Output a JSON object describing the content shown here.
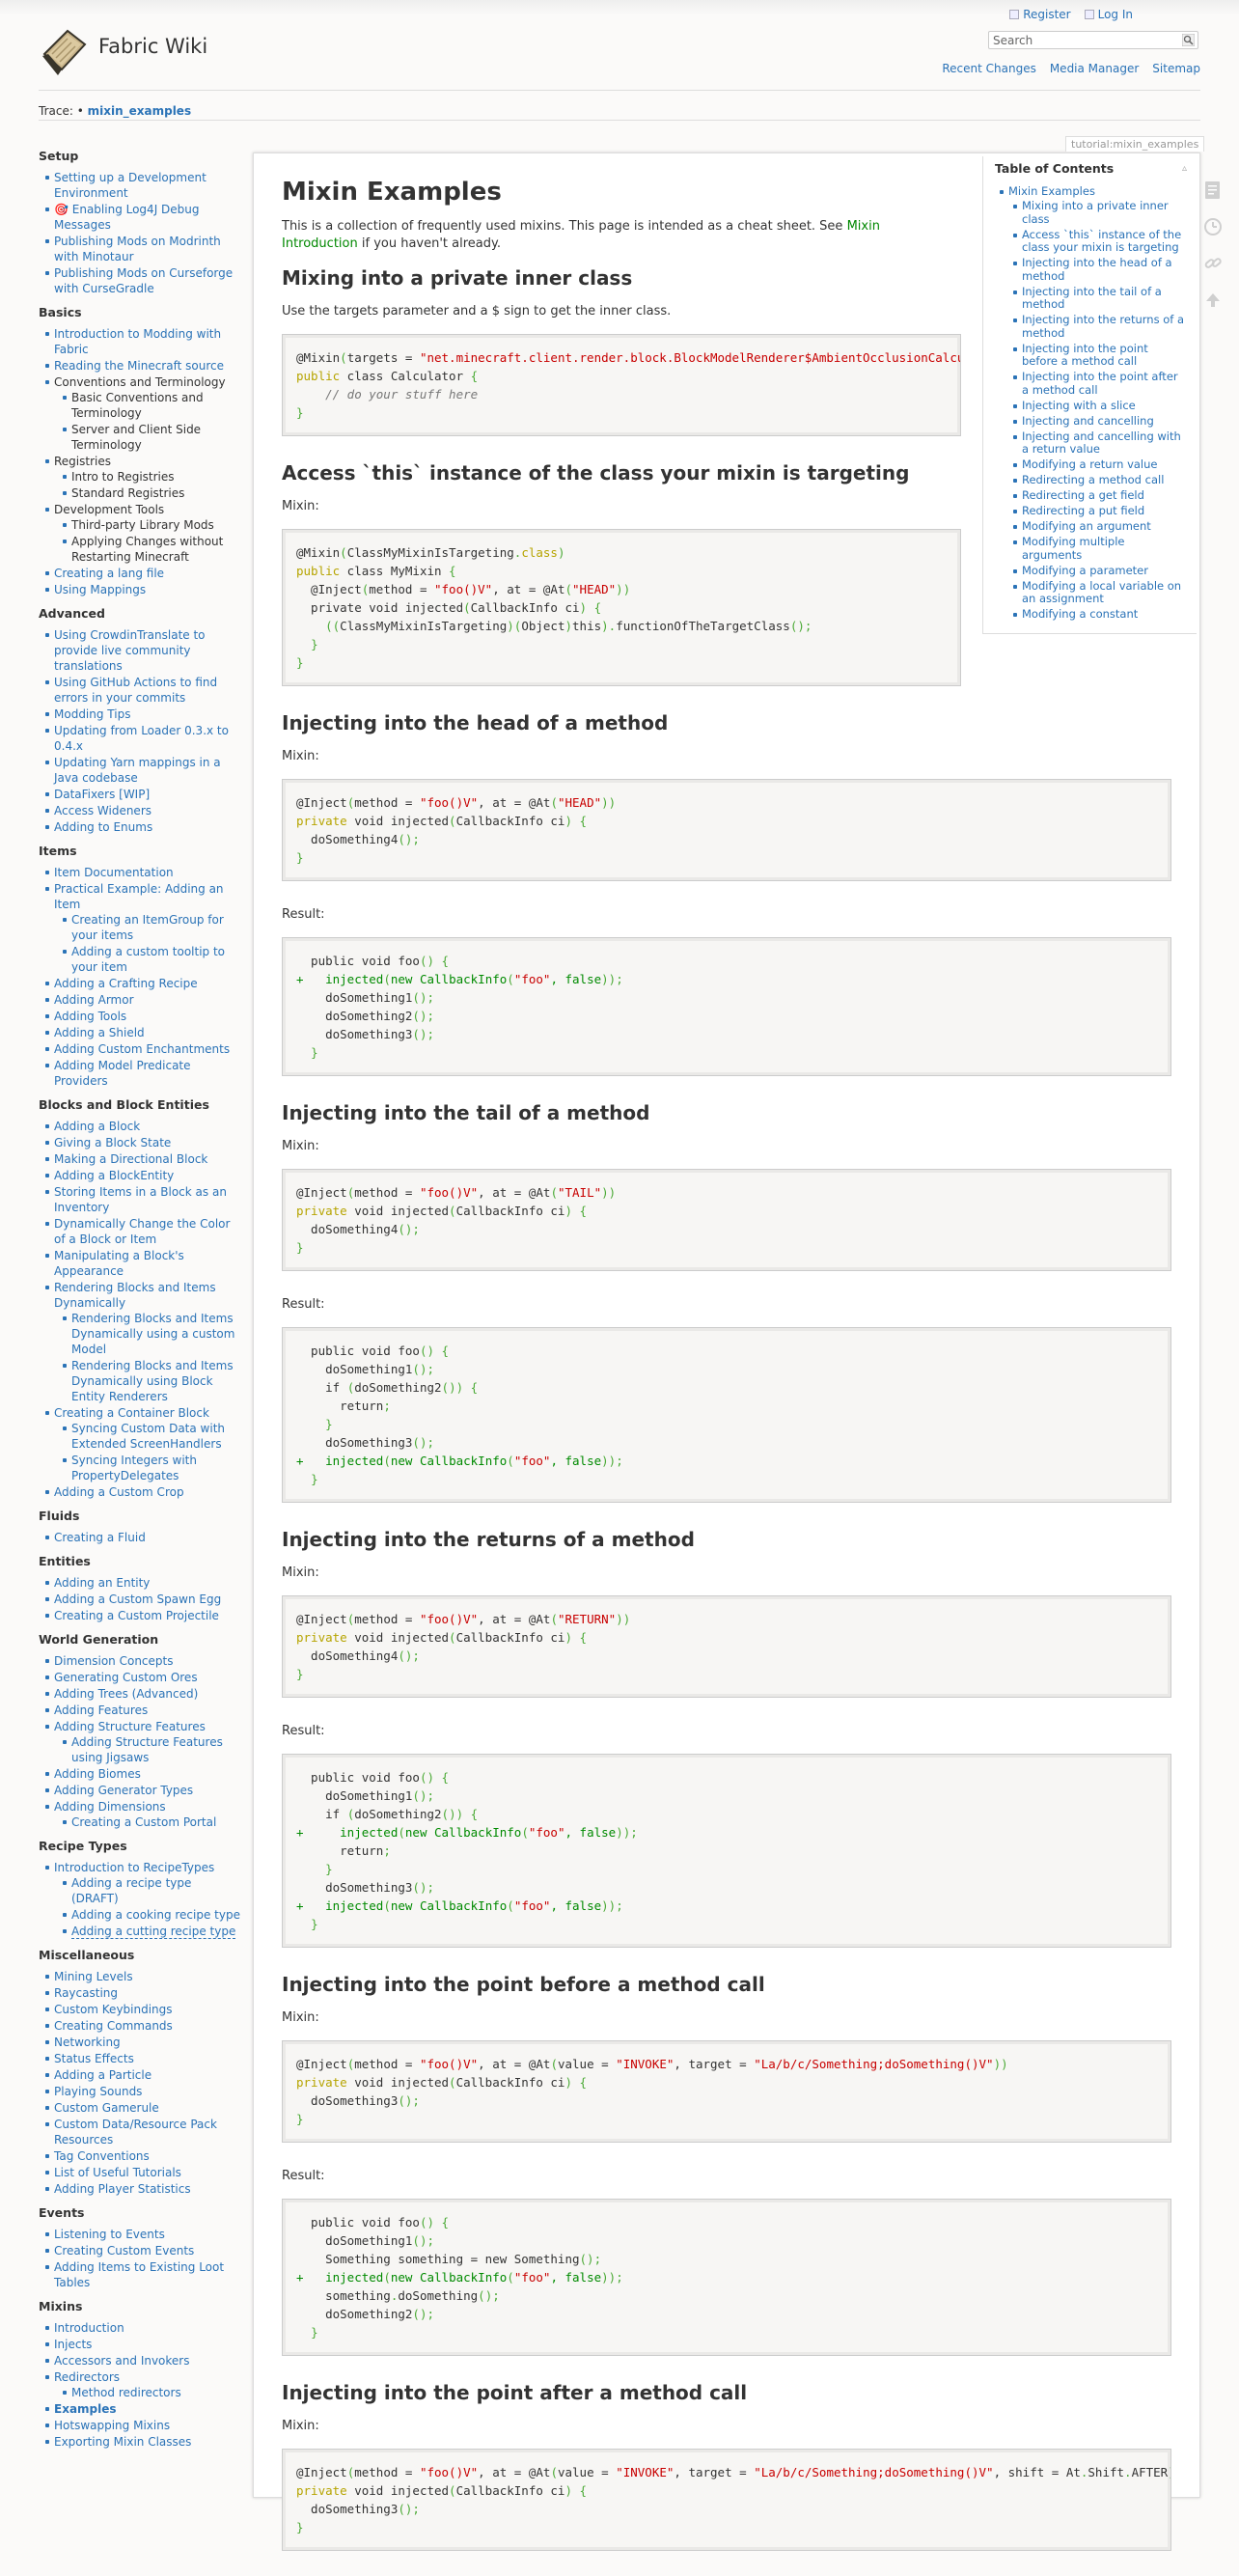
{
  "header": {
    "site_title": "Fabric Wiki",
    "register": "Register",
    "login": "Log In",
    "search_placeholder": "Search",
    "site_tools": [
      "Recent Changes",
      "Media Manager",
      "Sitemap"
    ],
    "trace_label": "Trace: •",
    "trace_page": "mixin_examples"
  },
  "page_id": "tutorial:mixin_examples",
  "sidebar": [
    {
      "title": "Setup",
      "items": [
        {
          "t": "Setting up a Development Environment"
        },
        {
          "t": "🎯 Enabling Log4J Debug Messages"
        },
        {
          "t": "Publishing Mods on Modrinth with Minotaur"
        },
        {
          "t": "Publishing Mods on Curseforge with CurseGradle"
        }
      ]
    },
    {
      "title": "Basics",
      "items": [
        {
          "t": "Introduction to Modding with Fabric"
        },
        {
          "t": "Reading the Minecraft source"
        },
        {
          "t": "Conventions and Terminology",
          "plain": true,
          "sub": [
            "Basic Conventions and Terminology",
            "Server and Client Side Terminology"
          ]
        },
        {
          "t": "Registries",
          "plain": true,
          "sub": [
            "Intro to Registries",
            "Standard Registries"
          ]
        },
        {
          "t": "Development Tools",
          "plain": true,
          "sub": [
            "Third-party Library Mods",
            "Applying Changes without Restarting Minecraft"
          ]
        },
        {
          "t": "Creating a lang file"
        },
        {
          "t": "Using Mappings"
        }
      ]
    },
    {
      "title": "Advanced",
      "items": [
        {
          "t": "Using CrowdinTranslate to provide live community translations"
        },
        {
          "t": "Using GitHub Actions to find errors in your commits"
        },
        {
          "t": "Modding Tips"
        },
        {
          "t": "Updating from Loader 0.3.x to 0.4.x"
        },
        {
          "t": "Updating Yarn mappings in a Java codebase"
        },
        {
          "t": "DataFixers [WIP]"
        },
        {
          "t": "Access Wideners"
        },
        {
          "t": "Adding to Enums"
        }
      ]
    },
    {
      "title": "Items",
      "items": [
        {
          "t": "Item Documentation"
        },
        {
          "t": "Practical Example: Adding an Item",
          "sub": [
            "Creating an ItemGroup for your items",
            "Adding a custom tooltip to your item"
          ]
        },
        {
          "t": "Adding a Crafting Recipe"
        },
        {
          "t": "Adding Armor"
        },
        {
          "t": "Adding Tools"
        },
        {
          "t": "Adding a Shield"
        },
        {
          "t": "Adding Custom Enchantments"
        },
        {
          "t": "Adding Model Predicate Providers"
        }
      ]
    },
    {
      "title": "Blocks and Block Entities",
      "items": [
        {
          "t": "Adding a Block"
        },
        {
          "t": "Giving a Block State"
        },
        {
          "t": "Making a Directional Block"
        },
        {
          "t": "Adding a BlockEntity"
        },
        {
          "t": "Storing Items in a Block as an Inventory"
        },
        {
          "t": "Dynamically Change the Color of a Block or Item"
        },
        {
          "t": "Manipulating a Block's Appearance"
        },
        {
          "t": "Rendering Blocks and Items Dynamically",
          "sub": [
            "Rendering Blocks and Items Dynamically using a custom Model",
            "Rendering Blocks and Items Dynamically using Block Entity Renderers"
          ]
        },
        {
          "t": "Creating a Container Block",
          "sub": [
            "Syncing Custom Data with Extended ScreenHandlers",
            "Syncing Integers with PropertyDelegates"
          ]
        },
        {
          "t": "Adding a Custom Crop"
        }
      ]
    },
    {
      "title": "Fluids",
      "items": [
        {
          "t": "Creating a Fluid"
        }
      ]
    },
    {
      "title": "Entities",
      "items": [
        {
          "t": "Adding an Entity"
        },
        {
          "t": "Adding a Custom Spawn Egg"
        },
        {
          "t": "Creating a Custom Projectile"
        }
      ]
    },
    {
      "title": "World Generation",
      "items": [
        {
          "t": "Dimension Concepts"
        },
        {
          "t": "Generating Custom Ores"
        },
        {
          "t": "Adding Trees (Advanced)"
        },
        {
          "t": "Adding Features"
        },
        {
          "t": "Adding Structure Features",
          "sub": [
            "Adding Structure Features using Jigsaws"
          ]
        },
        {
          "t": "Adding Biomes"
        },
        {
          "t": "Adding Generator Types"
        },
        {
          "t": "Adding Dimensions",
          "sub": [
            "Creating a Custom Portal"
          ]
        }
      ]
    },
    {
      "title": "Recipe Types",
      "items": [
        {
          "t": "Introduction to RecipeTypes",
          "sub": [
            "Adding a recipe type (DRAFT)",
            "Adding a cooking recipe type",
            "Adding a cutting recipe type"
          ],
          "dashed_last": true
        }
      ]
    },
    {
      "title": "Miscellaneous",
      "items": [
        {
          "t": "Mining Levels"
        },
        {
          "t": "Raycasting"
        },
        {
          "t": "Custom Keybindings"
        },
        {
          "t": "Creating Commands"
        },
        {
          "t": "Networking"
        },
        {
          "t": "Status Effects"
        },
        {
          "t": "Adding a Particle"
        },
        {
          "t": "Playing Sounds"
        },
        {
          "t": "Custom Gamerule"
        },
        {
          "t": "Custom Data/Resource Pack Resources"
        },
        {
          "t": "Tag Conventions"
        },
        {
          "t": "List of Useful Tutorials"
        },
        {
          "t": "Adding Player Statistics"
        }
      ]
    },
    {
      "title": "Events",
      "items": [
        {
          "t": "Listening to Events"
        },
        {
          "t": "Creating Custom Events"
        },
        {
          "t": "Adding Items to Existing Loot Tables"
        }
      ]
    },
    {
      "title": "Mixins",
      "items": [
        {
          "t": "Introduction"
        },
        {
          "t": "Injects"
        },
        {
          "t": "Accessors and Invokers"
        },
        {
          "t": "Redirectors",
          "sub": [
            "Method redirectors"
          ]
        },
        {
          "t": "Examples",
          "current": true
        },
        {
          "t": "Hotswapping Mixins"
        },
        {
          "t": "Exporting Mixin Classes"
        }
      ]
    }
  ],
  "toc": {
    "title": "Table of Contents",
    "root": "Mixin Examples",
    "items": [
      "Mixing into a private inner class",
      "Access `this` instance of the class your mixin is targeting",
      "Injecting into the head of a method",
      "Injecting into the tail of a method",
      "Injecting into the returns of a method",
      "Injecting into the point before a method call",
      "Injecting into the point after a method call",
      "Injecting with a slice",
      "Injecting and cancelling",
      "Injecting and cancelling with a return value",
      "Modifying a return value",
      "Redirecting a method call",
      "Redirecting a get field",
      "Redirecting a put field",
      "Modifying an argument",
      "Modifying multiple arguments",
      "Modifying a parameter",
      "Modifying a local variable on an assignment",
      "Modifying a constant"
    ]
  },
  "content": {
    "title": "Mixin Examples",
    "intro_a": "This is a collection of frequently used mixins. This page is intended as a cheat sheet. See ",
    "intro_link": "Mixin Introduction",
    "intro_b": " if you haven't already.",
    "s1_title": "Mixing into a private inner class",
    "s1_text": "Use the targets parameter and a $ sign to get the inner class.",
    "s2_title": "Access `this` instance of the class your mixin is targeting",
    "mixin_label": "Mixin:",
    "result_label": "Result:",
    "s3_title": "Injecting into the head of a method",
    "s4_title": "Injecting into the tail of a method",
    "s5_title": "Injecting into the returns of a method",
    "s6_title": "Injecting into the point before a method call",
    "s7_title": "Injecting into the point after a method call",
    "code": {
      "c1": [
        "@Mixin(targets = \"net.minecraft.client.render.block.BlockModelRenderer$AmbientOcclusionCalculator\")",
        "public class Calculator {",
        "    // do your stuff here",
        "}"
      ],
      "c2": [
        "@Mixin(ClassMyMixinIsTargeting.class)",
        "public class MyMixin {",
        "  @Inject(method = \"foo()V\", at = @At(\"HEAD\"))",
        "  private void injected(CallbackInfo ci) {",
        "    ((ClassMyMixinIsTargeting)(Object)this).functionOfTheTargetClass();",
        "  }",
        "}"
      ],
      "c3": [
        "@Inject(method = \"foo()V\", at = @At(\"HEAD\"))",
        "private void injected(CallbackInfo ci) {",
        "  doSomething4();",
        "}"
      ],
      "c3r": [
        "  public void foo() {",
        "+   injected(new CallbackInfo(\"foo\", false));",
        "    doSomething1();",
        "    doSomething2();",
        "    doSomething3();",
        "  }"
      ],
      "c4": [
        "@Inject(method = \"foo()V\", at = @At(\"TAIL\"))",
        "private void injected(CallbackInfo ci) {",
        "  doSomething4();",
        "}"
      ],
      "c4r": [
        "  public void foo() {",
        "    doSomething1();",
        "    if (doSomething2()) {",
        "      return;",
        "    }",
        "    doSomething3();",
        "+   injected(new CallbackInfo(\"foo\", false));",
        "  }"
      ],
      "c5": [
        "@Inject(method = \"foo()V\", at = @At(\"RETURN\"))",
        "private void injected(CallbackInfo ci) {",
        "  doSomething4();",
        "}"
      ],
      "c5r": [
        "  public void foo() {",
        "    doSomething1();",
        "    if (doSomething2()) {",
        "+     injected(new CallbackInfo(\"foo\", false));",
        "      return;",
        "    }",
        "    doSomething3();",
        "+   injected(new CallbackInfo(\"foo\", false));",
        "  }"
      ],
      "c6": [
        "@Inject(method = \"foo()V\", at = @At(value = \"INVOKE\", target = \"La/b/c/Something;doSomething()V\"))",
        "private void injected(CallbackInfo ci) {",
        "  doSomething3();",
        "}"
      ],
      "c6r": [
        "  public void foo() {",
        "    doSomething1();",
        "    Something something = new Something();",
        "+   injected(new CallbackInfo(\"foo\", false));",
        "    something.doSomething();",
        "    doSomething2();",
        "  }"
      ],
      "c7": [
        "@Inject(method = \"foo()V\", at = @At(value = \"INVOKE\", target = \"La/b/c/Something;doSomething()V\", shift = At.Shift.AFTER))",
        "private void injected(CallbackInfo ci) {",
        "  doSomething3();",
        "}"
      ]
    }
  }
}
